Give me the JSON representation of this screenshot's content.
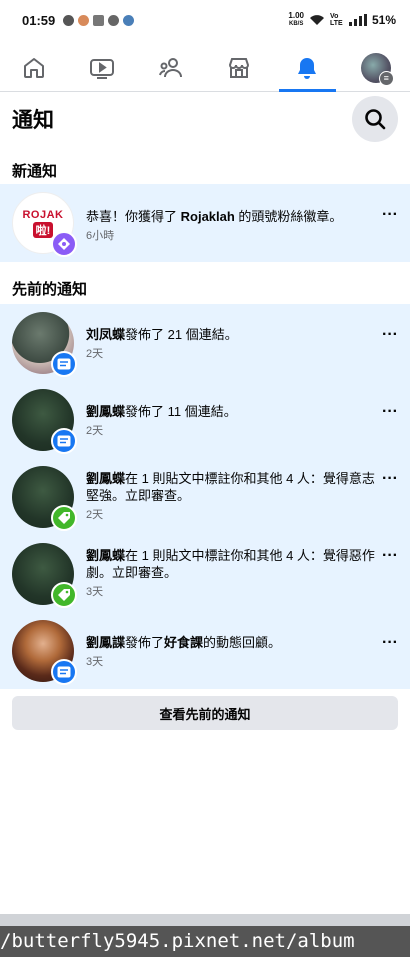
{
  "status_bar": {
    "time": "01:59",
    "speed_value": "1.00",
    "speed_unit": "KB/S",
    "network": "Vo LTE",
    "battery": "51%"
  },
  "nav": {
    "tabs": [
      {
        "name": "home-icon"
      },
      {
        "name": "video-icon"
      },
      {
        "name": "friends-icon"
      },
      {
        "name": "marketplace-icon"
      },
      {
        "name": "bell-icon",
        "active": true
      },
      {
        "name": "profile-menu"
      }
    ]
  },
  "header": {
    "title": "通知"
  },
  "sections": {
    "new": "新通知",
    "earlier": "先前的通知"
  },
  "new_notification": {
    "logo_line1": "ROJAK",
    "logo_line2": "啦!",
    "text_prefix": "恭喜！你獲得了 ",
    "text_bold": "Rojaklah",
    "text_suffix": " 的頭號粉絲徽章。",
    "time": "6小時"
  },
  "earlier_notifications": [
    {
      "name": "刘凤蝶",
      "text": "發佈了 21 個連結。",
      "time": "2天"
    },
    {
      "name": "劉鳳蝶",
      "text": "發佈了 11 個連結。",
      "time": "2天"
    },
    {
      "name": "劉鳳蝶",
      "text": "在 1 則貼文中標註你和其他 4 人：覺得意志堅強。立即審查。",
      "time": "2天"
    },
    {
      "name": "劉鳳蝶",
      "text": "在 1 則貼文中標註你和其他 4 人：覺得惡作劇。立即審查。",
      "time": "3天"
    },
    {
      "name": "劉鳳諜",
      "text": "發佈了",
      "bold2": "好食課",
      "text2": "的動態回顧。",
      "time": "3天"
    }
  ],
  "see_more_label": "查看先前的通知",
  "watermark": "/butterfly5945.pixnet.net/album",
  "colors": {
    "accent": "#1877f2",
    "unread_bg": "#e7f3ff",
    "badge_green": "#42b72a",
    "badge_purple": "#8b5cf6"
  }
}
